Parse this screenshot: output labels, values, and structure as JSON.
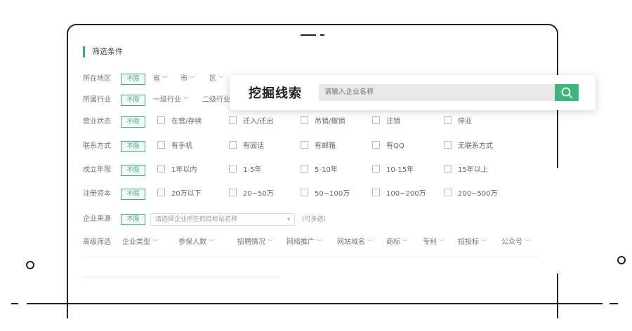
{
  "panel": {
    "title": "筛选条件",
    "unlimited_tag": "不限",
    "rows": [
      {
        "label": "所在地区",
        "dropdowns": [
          "省",
          "市",
          "区"
        ]
      },
      {
        "label": "所属行业",
        "dropdowns": [
          "一级行业",
          "二级行业"
        ]
      },
      {
        "label": "营业状态",
        "options": [
          "在营/存续",
          "迁入/迁出",
          "吊销/撤销",
          "注销",
          "停业"
        ]
      },
      {
        "label": "联系方式",
        "options": [
          "有手机",
          "有固话",
          "有邮箱",
          "有QQ",
          "无联系方式"
        ]
      },
      {
        "label": "成立年限",
        "options": [
          "1年以内",
          "1-5年",
          "5-10年",
          "10-15年",
          "15年以上"
        ]
      },
      {
        "label": "注册资本",
        "options": [
          "20万以下",
          "20~50万",
          "50~100万",
          "100~200万",
          "200~500万"
        ]
      },
      {
        "label": "企业来源",
        "select_placeholder": "请选择企业所在的目标站名称",
        "hint": "(可多选)"
      },
      {
        "label": "高级筛选",
        "dropdowns": [
          "企业类型",
          "参保人数",
          "招聘情况",
          "网络推广",
          "网站域名",
          "商标",
          "专利",
          "招投标",
          "公众号"
        ]
      }
    ]
  },
  "search": {
    "title": "挖掘线索",
    "placeholder": "请输入企业名称",
    "button_icon": "search-icon",
    "accent_color": "#3fb57a"
  },
  "colors": {
    "tag": "#3fa98a",
    "frame": "#222222"
  }
}
